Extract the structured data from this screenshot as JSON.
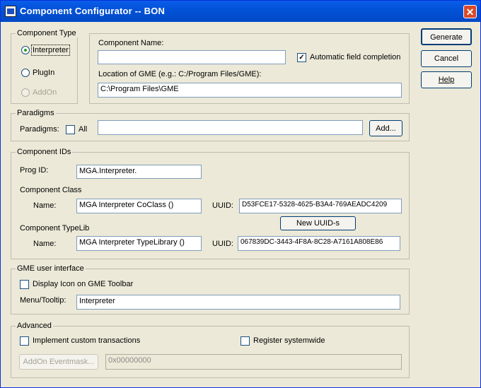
{
  "window": {
    "title": "Component Configurator -- BON",
    "close_glyph": "✕"
  },
  "component_type": {
    "legend": "Component Type",
    "options": [
      {
        "label": "Interpreter",
        "selected": true,
        "enabled": true
      },
      {
        "label": "PlugIn",
        "selected": false,
        "enabled": true
      },
      {
        "label": "AddOn",
        "selected": false,
        "enabled": false
      }
    ]
  },
  "component_name": {
    "label": "Component Name:",
    "value": "",
    "auto_completion_label": "Automatic field completion",
    "auto_completion_checked": true
  },
  "gme_location": {
    "label": "Location of GME (e.g.: C:/Program Files/GME):",
    "value": "C:\\Program Files\\GME"
  },
  "paradigms": {
    "legend": "Paradigms",
    "label": "Paradigms:",
    "all_label": "All",
    "all_checked": false,
    "value": "",
    "add_button": "Add..."
  },
  "component_ids": {
    "legend": "Component IDs",
    "prog_id_label": "Prog ID:",
    "prog_id_value": "MGA.Interpreter.",
    "class_heading": "Component Class",
    "class_name_label": "Name:",
    "class_name_value": "MGA Interpreter CoClass ()",
    "class_uuid_label": "UUID:",
    "class_uuid_value": "D53FCE17-5328-4625-B3A4-769AEADC4209",
    "new_uuids_button": "New UUID-s",
    "typelib_heading": "Component TypeLib",
    "typelib_name_label": "Name:",
    "typelib_name_value": "MGA Interpreter TypeLibrary ()",
    "typelib_uuid_label": "UUID:",
    "typelib_uuid_value": "067839DC-3443-4F8A-8C28-A7161A808E86"
  },
  "gme_ui": {
    "legend": "GME user interface",
    "display_icon_label": "Display Icon on GME Toolbar",
    "display_icon_checked": false,
    "menu_tooltip_label": "Menu/Tooltip:",
    "menu_tooltip_value": "Interpreter"
  },
  "advanced": {
    "legend": "Advanced",
    "custom_transactions_label": "Implement custom transactions",
    "custom_transactions_checked": false,
    "register_systemwide_label": "Register systemwide",
    "register_systemwide_checked": false,
    "eventmask_button": "AddOn Eventmask...",
    "eventmask_value": "0x00000000"
  },
  "buttons": {
    "generate": "Generate",
    "cancel": "Cancel",
    "help": "Help"
  }
}
